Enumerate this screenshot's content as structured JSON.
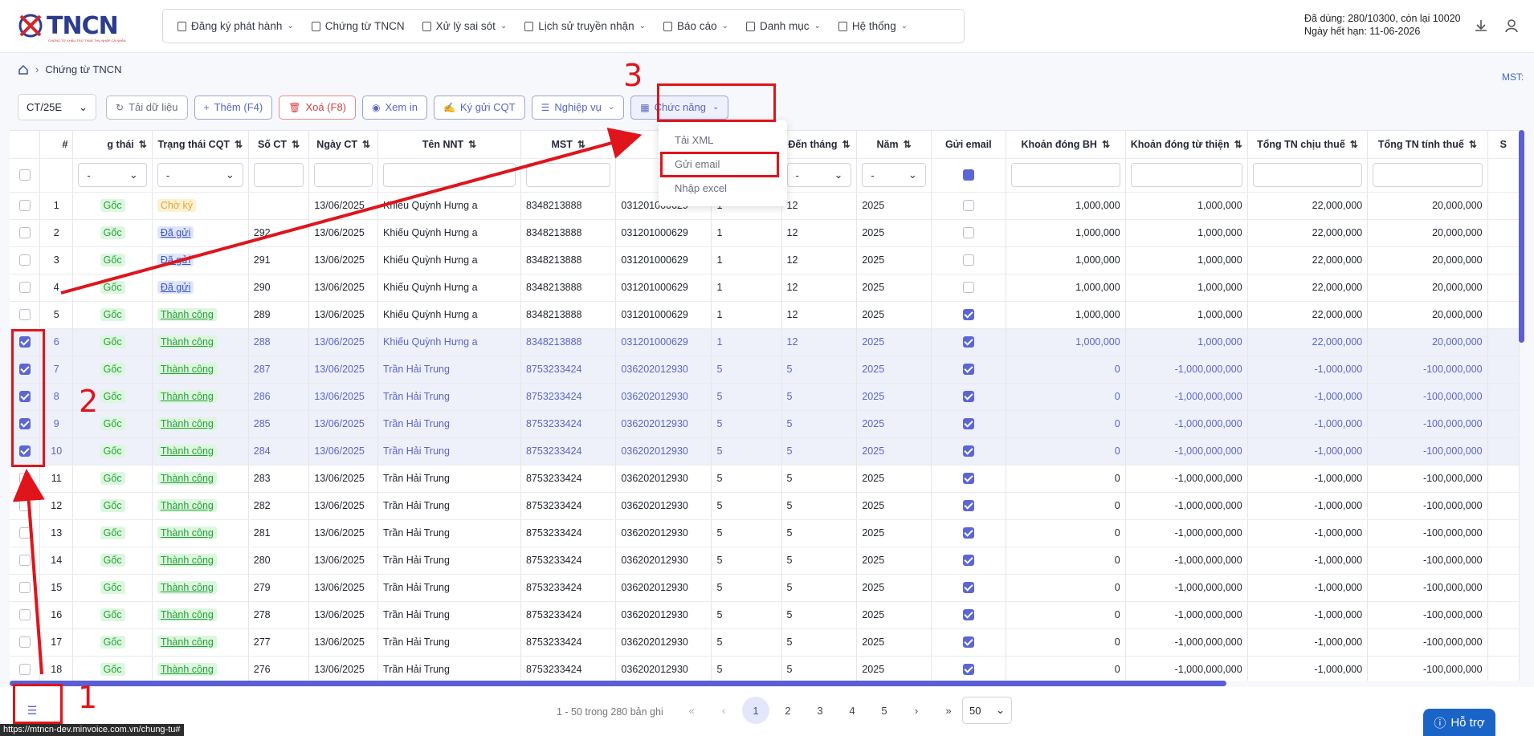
{
  "app": {
    "logo_text": "TNCN",
    "logo_sub": "CHỨNG TỪ KHẤU TRỪ THUẾ THU NHẬP CÁ NHÂN"
  },
  "menu": [
    {
      "label": "Đăng ký phát hành",
      "dropdown": true
    },
    {
      "label": "Chứng từ TNCN",
      "dropdown": false
    },
    {
      "label": "Xử lý sai sót",
      "dropdown": true
    },
    {
      "label": "Lịch sử truyền nhận",
      "dropdown": true
    },
    {
      "label": "Báo cáo",
      "dropdown": true
    },
    {
      "label": "Danh mục",
      "dropdown": true
    },
    {
      "label": "Hệ thống",
      "dropdown": true
    }
  ],
  "quota": {
    "line1": "Đã dùng: 280/10300, còn lại 10020",
    "line2": "Ngày hết hạn: 11-06-2026"
  },
  "breadcrumb": {
    "page": "Chứng từ TNCN"
  },
  "mst_label": "MST:",
  "toolbar": {
    "template": "CT/25E",
    "reload": "Tải dữ liệu",
    "add": "Thêm (F4)",
    "delete": "Xoá (F8)",
    "view": "Xem in",
    "sign": "Ký gửi CQT",
    "business": "Nghiệp vụ",
    "functions": "Chức năng"
  },
  "dropdown": {
    "items": [
      "Tải XML",
      "Gửi email",
      "Nhập excel"
    ]
  },
  "columns": [
    "#",
    "g thái",
    "Trạng thái CQT",
    "Số CT",
    "Ngày CT",
    "Tên NNT",
    "MST",
    "C",
    "",
    "Đến tháng",
    "Năm",
    "Gửi email",
    "Khoản đóng BH",
    "Khoản đóng từ thiện",
    "Tổng TN chịu thuế",
    "Tổng TN tính thuế",
    "S"
  ],
  "filters": {
    "dash": "-"
  },
  "rows": [
    {
      "n": "1",
      "ts": "Gốc",
      "cqt": "Chờ ký",
      "cqt_type": "cho",
      "so": "",
      "ngay": "13/06/2025",
      "ten": "Khiếu Quỳnh Hưng a",
      "mst": "8348213888",
      "cccd": "031201000629",
      "tu": "1",
      "den": "12",
      "nam": "2025",
      "email": false,
      "bh": "1,000,000",
      "tt": "1,000,000",
      "chiu": "22,000,000",
      "tinh": "20,000,000",
      "sel": false
    },
    {
      "n": "2",
      "ts": "Gốc",
      "cqt": "Đã gửi",
      "cqt_type": "dagui",
      "so": "292",
      "ngay": "13/06/2025",
      "ten": "Khiếu Quỳnh Hưng a",
      "mst": "8348213888",
      "cccd": "031201000629",
      "tu": "1",
      "den": "12",
      "nam": "2025",
      "email": false,
      "bh": "1,000,000",
      "tt": "1,000,000",
      "chiu": "22,000,000",
      "tinh": "20,000,000",
      "sel": false
    },
    {
      "n": "3",
      "ts": "Gốc",
      "cqt": "Đã gửi",
      "cqt_type": "dagui",
      "so": "291",
      "ngay": "13/06/2025",
      "ten": "Khiếu Quỳnh Hưng a",
      "mst": "8348213888",
      "cccd": "031201000629",
      "tu": "1",
      "den": "12",
      "nam": "2025",
      "email": false,
      "bh": "1,000,000",
      "tt": "1,000,000",
      "chiu": "22,000,000",
      "tinh": "20,000,000",
      "sel": false
    },
    {
      "n": "4",
      "ts": "Gốc",
      "cqt": "Đã gửi",
      "cqt_type": "dagui",
      "so": "290",
      "ngay": "13/06/2025",
      "ten": "Khiếu Quỳnh Hưng a",
      "mst": "8348213888",
      "cccd": "031201000629",
      "tu": "1",
      "den": "12",
      "nam": "2025",
      "email": false,
      "bh": "1,000,000",
      "tt": "1,000,000",
      "chiu": "22,000,000",
      "tinh": "20,000,000",
      "sel": false
    },
    {
      "n": "5",
      "ts": "Gốc",
      "cqt": "Thành công",
      "cqt_type": "tc",
      "so": "289",
      "ngay": "13/06/2025",
      "ten": "Khiếu Quỳnh Hưng a",
      "mst": "8348213888",
      "cccd": "031201000629",
      "tu": "1",
      "den": "12",
      "nam": "2025",
      "email": true,
      "bh": "1,000,000",
      "tt": "1,000,000",
      "chiu": "22,000,000",
      "tinh": "20,000,000",
      "sel": false
    },
    {
      "n": "6",
      "ts": "Gốc",
      "cqt": "Thành công",
      "cqt_type": "tc",
      "so": "288",
      "ngay": "13/06/2025",
      "ten": "Khiếu Quỳnh Hưng a",
      "mst": "8348213888",
      "cccd": "031201000629",
      "tu": "1",
      "den": "12",
      "nam": "2025",
      "email": true,
      "bh": "1,000,000",
      "tt": "1,000,000",
      "chiu": "22,000,000",
      "tinh": "20,000,000",
      "sel": true
    },
    {
      "n": "7",
      "ts": "Gốc",
      "cqt": "Thành công",
      "cqt_type": "tc",
      "so": "287",
      "ngay": "13/06/2025",
      "ten": "Trần Hải Trung",
      "mst": "8753233424",
      "cccd": "036202012930",
      "tu": "5",
      "den": "5",
      "nam": "2025",
      "email": true,
      "bh": "0",
      "tt": "-1,000,000,000",
      "chiu": "-1,000,000",
      "tinh": "-100,000,000",
      "sel": true
    },
    {
      "n": "8",
      "ts": "Gốc",
      "cqt": "Thành công",
      "cqt_type": "tc",
      "so": "286",
      "ngay": "13/06/2025",
      "ten": "Trần Hải Trung",
      "mst": "8753233424",
      "cccd": "036202012930",
      "tu": "5",
      "den": "5",
      "nam": "2025",
      "email": true,
      "bh": "0",
      "tt": "-1,000,000,000",
      "chiu": "-1,000,000",
      "tinh": "-100,000,000",
      "sel": true
    },
    {
      "n": "9",
      "ts": "Gốc",
      "cqt": "Thành công",
      "cqt_type": "tc",
      "so": "285",
      "ngay": "13/06/2025",
      "ten": "Trần Hải Trung",
      "mst": "8753233424",
      "cccd": "036202012930",
      "tu": "5",
      "den": "5",
      "nam": "2025",
      "email": true,
      "bh": "0",
      "tt": "-1,000,000,000",
      "chiu": "-1,000,000",
      "tinh": "-100,000,000",
      "sel": true
    },
    {
      "n": "10",
      "ts": "Gốc",
      "cqt": "Thành công",
      "cqt_type": "tc",
      "so": "284",
      "ngay": "13/06/2025",
      "ten": "Trần Hải Trung",
      "mst": "8753233424",
      "cccd": "036202012930",
      "tu": "5",
      "den": "5",
      "nam": "2025",
      "email": true,
      "bh": "0",
      "tt": "-1,000,000,000",
      "chiu": "-1,000,000",
      "tinh": "-100,000,000",
      "sel": true
    },
    {
      "n": "11",
      "ts": "Gốc",
      "cqt": "Thành công",
      "cqt_type": "tc",
      "so": "283",
      "ngay": "13/06/2025",
      "ten": "Trần Hải Trung",
      "mst": "8753233424",
      "cccd": "036202012930",
      "tu": "5",
      "den": "5",
      "nam": "2025",
      "email": true,
      "bh": "0",
      "tt": "-1,000,000,000",
      "chiu": "-1,000,000",
      "tinh": "-100,000,000",
      "sel": false
    },
    {
      "n": "12",
      "ts": "Gốc",
      "cqt": "Thành công",
      "cqt_type": "tc",
      "so": "282",
      "ngay": "13/06/2025",
      "ten": "Trần Hải Trung",
      "mst": "8753233424",
      "cccd": "036202012930",
      "tu": "5",
      "den": "5",
      "nam": "2025",
      "email": true,
      "bh": "0",
      "tt": "-1,000,000,000",
      "chiu": "-1,000,000",
      "tinh": "-100,000,000",
      "sel": false
    },
    {
      "n": "13",
      "ts": "Gốc",
      "cqt": "Thành công",
      "cqt_type": "tc",
      "so": "281",
      "ngay": "13/06/2025",
      "ten": "Trần Hải Trung",
      "mst": "8753233424",
      "cccd": "036202012930",
      "tu": "5",
      "den": "5",
      "nam": "2025",
      "email": true,
      "bh": "0",
      "tt": "-1,000,000,000",
      "chiu": "-1,000,000",
      "tinh": "-100,000,000",
      "sel": false
    },
    {
      "n": "14",
      "ts": "Gốc",
      "cqt": "Thành công",
      "cqt_type": "tc",
      "so": "280",
      "ngay": "13/06/2025",
      "ten": "Trần Hải Trung",
      "mst": "8753233424",
      "cccd": "036202012930",
      "tu": "5",
      "den": "5",
      "nam": "2025",
      "email": true,
      "bh": "0",
      "tt": "-1,000,000,000",
      "chiu": "-1,000,000",
      "tinh": "-100,000,000",
      "sel": false
    },
    {
      "n": "15",
      "ts": "Gốc",
      "cqt": "Thành công",
      "cqt_type": "tc",
      "so": "279",
      "ngay": "13/06/2025",
      "ten": "Trần Hải Trung",
      "mst": "8753233424",
      "cccd": "036202012930",
      "tu": "5",
      "den": "5",
      "nam": "2025",
      "email": true,
      "bh": "0",
      "tt": "-1,000,000,000",
      "chiu": "-1,000,000",
      "tinh": "-100,000,000",
      "sel": false
    },
    {
      "n": "16",
      "ts": "Gốc",
      "cqt": "Thành công",
      "cqt_type": "tc",
      "so": "278",
      "ngay": "13/06/2025",
      "ten": "Trần Hải Trung",
      "mst": "8753233424",
      "cccd": "036202012930",
      "tu": "5",
      "den": "5",
      "nam": "2025",
      "email": true,
      "bh": "0",
      "tt": "-1,000,000,000",
      "chiu": "-1,000,000",
      "tinh": "-100,000,000",
      "sel": false
    },
    {
      "n": "17",
      "ts": "Gốc",
      "cqt": "Thành công",
      "cqt_type": "tc",
      "so": "277",
      "ngay": "13/06/2025",
      "ten": "Trần Hải Trung",
      "mst": "8753233424",
      "cccd": "036202012930",
      "tu": "5",
      "den": "5",
      "nam": "2025",
      "email": true,
      "bh": "0",
      "tt": "-1,000,000,000",
      "chiu": "-1,000,000",
      "tinh": "-100,000,000",
      "sel": false
    },
    {
      "n": "18",
      "ts": "Gốc",
      "cqt": "Thành công",
      "cqt_type": "tc",
      "so": "276",
      "ngay": "13/06/2025",
      "ten": "Trần Hải Trung",
      "mst": "8753233424",
      "cccd": "036202012930",
      "tu": "5",
      "den": "5",
      "nam": "2025",
      "email": true,
      "bh": "0",
      "tt": "-1,000,000,000",
      "chiu": "-1,000,000",
      "tinh": "-100,000,000",
      "sel": false
    }
  ],
  "pagination": {
    "info": "1 - 50 trong 280 bản ghi",
    "pages": [
      "1",
      "2",
      "3",
      "4",
      "5"
    ],
    "current": "1",
    "page_size": "50"
  },
  "status_url": "https://mtncn-dev.minvoice.com.vn/chung-tu#",
  "help": "Hỗ trợ",
  "annotations": {
    "n1": "1",
    "n2": "2",
    "n3": "3",
    "color": "#e0141b"
  },
  "colors": {
    "accent": "#5b66d6",
    "brand": "#2c3d8f"
  }
}
